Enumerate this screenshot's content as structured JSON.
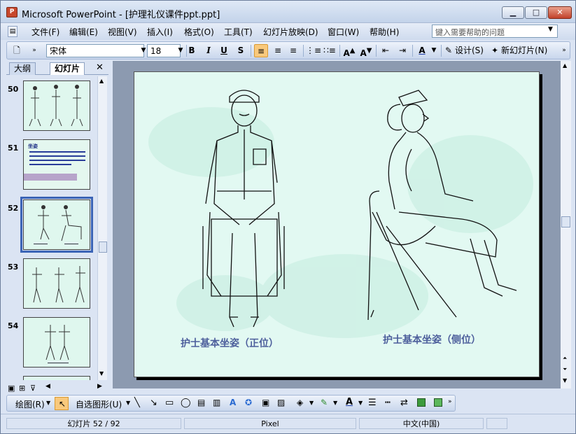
{
  "window": {
    "title": "Microsoft PowerPoint - [护理礼仪课件ppt.ppt]",
    "app_icon_label": "P"
  },
  "menu": {
    "items": [
      "文件(F)",
      "编辑(E)",
      "视图(V)",
      "插入(I)",
      "格式(O)",
      "工具(T)",
      "幻灯片放映(D)",
      "窗口(W)",
      "帮助(H)"
    ],
    "help_placeholder": "键入需要帮助的问题"
  },
  "toolbar": {
    "font_name": "宋体",
    "font_size": "18",
    "bold": "B",
    "italic": "I",
    "underline": "U",
    "shadow": "S",
    "design_label": "设计(S)",
    "new_slide_label": "新幻灯片(N)"
  },
  "panel": {
    "tab_outline": "大纲",
    "tab_slides": "幻灯片",
    "slide_numbers": [
      "50",
      "51",
      "52",
      "53",
      "54"
    ],
    "selected_slide": "52",
    "slide51_title": "坐姿"
  },
  "slide": {
    "caption_left": "护士基本坐姿（正位）",
    "caption_right": "护士基本坐姿（侧位）"
  },
  "drawing": {
    "draw_label": "绘图(R)",
    "autoshapes_label": "自选图形(U)"
  },
  "status": {
    "slide_pos": "幻灯片 52 / 92",
    "design": "Pixel",
    "language": "中文(中国)"
  },
  "colors": {
    "slide_bg": "#e2f9f2",
    "caption": "#4d5f9c",
    "selected_border": "#3b64b6",
    "highlight_button": "#f9c97c"
  }
}
